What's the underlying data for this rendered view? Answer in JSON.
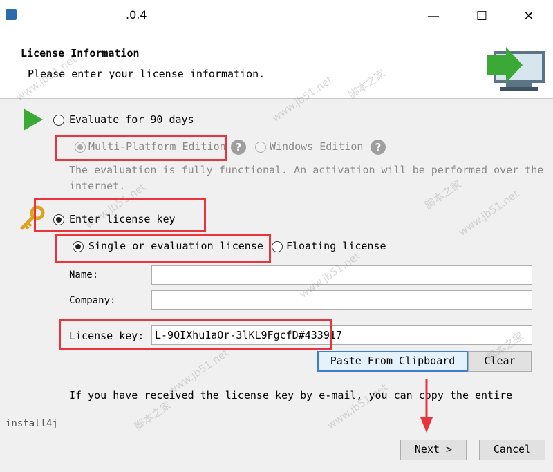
{
  "window": {
    "title": ".0.4",
    "minimize_glyph": "—",
    "maximize_glyph": "☐",
    "close_glyph": "✕"
  },
  "header": {
    "title": "License Information",
    "subtitle": "Please enter your license information."
  },
  "evaluate": {
    "label": "Evaluate for 90 days",
    "selected": false,
    "editions": [
      {
        "label": "Multi-Platform Edition",
        "selected": true,
        "enabled": false
      },
      {
        "label": "Windows Edition",
        "selected": false,
        "enabled": false
      }
    ],
    "help_glyph": "?",
    "description_line1": "The evaluation is fully functional. An activation will be performed over the",
    "description_line2": "internet."
  },
  "license": {
    "label": "Enter license key",
    "selected": true,
    "options": [
      {
        "label": "Single or evaluation license",
        "selected": true
      },
      {
        "label": "Floating license",
        "selected": false
      }
    ],
    "name_label": "Name:",
    "name_value": "",
    "company_label": "Company:",
    "company_value": "",
    "key_label": "License key:",
    "key_value": "L-9QIXhu1aOr-3lKL9FgcfD#433917",
    "paste_button": "Paste From Clipboard",
    "clear_button": "Clear",
    "info_line": "If you have received the license key by e-mail, you can copy the entire"
  },
  "footer": {
    "brand": "install4j",
    "next_button": "Next >",
    "cancel_button": "Cancel"
  },
  "watermark": "www.jb51.net",
  "watermark_cn": "脚本之家",
  "colors": {
    "highlight_box": "#e8343b",
    "arrow": "#e8343b",
    "play_icon": "#3aa935",
    "key_icon": "#e0a020"
  }
}
